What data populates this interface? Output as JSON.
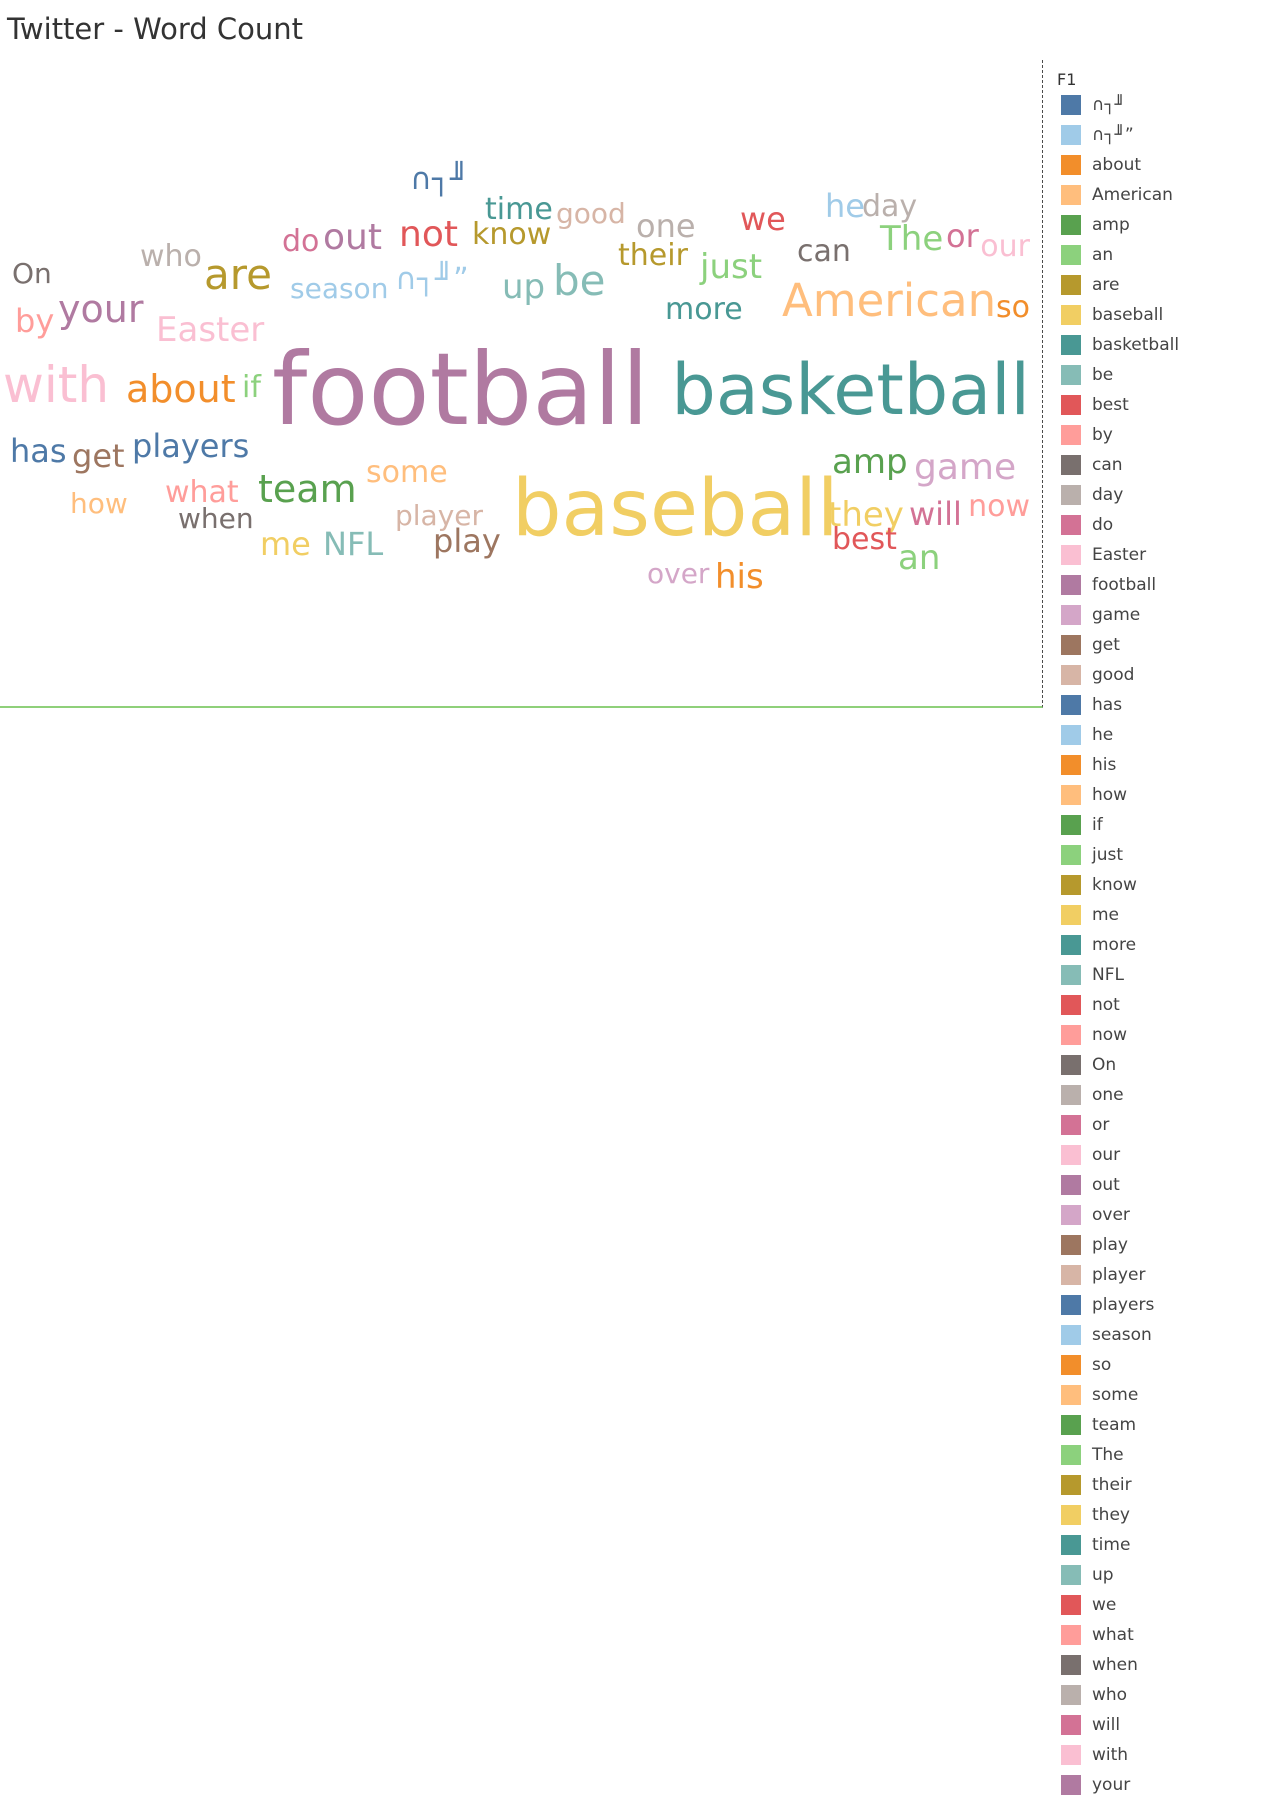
{
  "page": {
    "title": "Twitter - Word Count"
  },
  "chart_data": {
    "type": "wordcloud",
    "title": "Twitter - Word Count",
    "legend_title": "F1",
    "legend_placement": "right",
    "words": [
      {
        "text": "football",
        "size": 100,
        "color": "#b07aa1"
      },
      {
        "text": "basketball",
        "size": 70,
        "color": "#499894"
      },
      {
        "text": "baseball",
        "size": 78,
        "color": "#f1ce63"
      },
      {
        "text": "American",
        "size": 45,
        "color": "#ffbe7d"
      },
      {
        "text": "with",
        "size": 50,
        "color": "#fabfd2"
      },
      {
        "text": "are",
        "size": 42,
        "color": "#b6992d"
      },
      {
        "text": "be",
        "size": 42,
        "color": "#86bcb6"
      },
      {
        "text": "about",
        "size": 38,
        "color": "#f28e2b"
      },
      {
        "text": "your",
        "size": 38,
        "color": "#b07aa1"
      },
      {
        "text": "team",
        "size": 38,
        "color": "#59a14f"
      },
      {
        "text": "amp",
        "size": 34,
        "color": "#59a14f"
      },
      {
        "text": "game",
        "size": 36,
        "color": "#d4a6c8"
      },
      {
        "text": "out",
        "size": 36,
        "color": "#b07aa1"
      },
      {
        "text": "not",
        "size": 36,
        "color": "#e15759"
      },
      {
        "text": "players",
        "size": 32,
        "color": "#4e79a7"
      },
      {
        "text": "has",
        "size": 32,
        "color": "#4e79a7"
      },
      {
        "text": "get",
        "size": 32,
        "color": "#9d7660"
      },
      {
        "text": "just",
        "size": 34,
        "color": "#8cd17d"
      },
      {
        "text": "The",
        "size": 34,
        "color": "#8cd17d"
      },
      {
        "text": "they",
        "size": 34,
        "color": "#f1ce63"
      },
      {
        "text": "will",
        "size": 32,
        "color": "#d37295"
      },
      {
        "text": "Easter",
        "size": 34,
        "color": "#fabfd2"
      },
      {
        "text": "his",
        "size": 34,
        "color": "#f28e2b"
      },
      {
        "text": "an",
        "size": 34,
        "color": "#8cd17d"
      },
      {
        "text": "more",
        "size": 30,
        "color": "#499894"
      },
      {
        "text": "can",
        "size": 30,
        "color": "#79706e"
      },
      {
        "text": "we",
        "size": 32,
        "color": "#e15759"
      },
      {
        "text": "or",
        "size": 32,
        "color": "#d37295"
      },
      {
        "text": "one",
        "size": 32,
        "color": "#bab0ac"
      },
      {
        "text": "time",
        "size": 30,
        "color": "#499894"
      },
      {
        "text": "he",
        "size": 32,
        "color": "#a0cbe8"
      },
      {
        "text": "day",
        "size": 30,
        "color": "#bab0ac"
      },
      {
        "text": "our",
        "size": 30,
        "color": "#fabfd2"
      },
      {
        "text": "so",
        "size": 30,
        "color": "#f28e2b"
      },
      {
        "text": "up",
        "size": 34,
        "color": "#86bcb6"
      },
      {
        "text": "their",
        "size": 30,
        "color": "#b6992d"
      },
      {
        "text": "know",
        "size": 30,
        "color": "#b6992d"
      },
      {
        "text": "some",
        "size": 30,
        "color": "#ffbe7d"
      },
      {
        "text": "play",
        "size": 32,
        "color": "#9d7660"
      },
      {
        "text": "NFL",
        "size": 32,
        "color": "#86bcb6"
      },
      {
        "text": "me",
        "size": 32,
        "color": "#f1ce63"
      },
      {
        "text": "best",
        "size": 30,
        "color": "#e15759"
      },
      {
        "text": "now",
        "size": 30,
        "color": "#ff9d9a"
      },
      {
        "text": "by",
        "size": 32,
        "color": "#ff9d9a"
      },
      {
        "text": "if",
        "size": 30,
        "color": "#8cd17d"
      },
      {
        "text": "On",
        "size": 28,
        "color": "#79706e"
      },
      {
        "text": "who",
        "size": 30,
        "color": "#bab0ac"
      },
      {
        "text": "do",
        "size": 30,
        "color": "#d37295"
      },
      {
        "text": "good",
        "size": 28,
        "color": "#d7b5a6"
      },
      {
        "text": "season",
        "size": 28,
        "color": "#a0cbe8"
      },
      {
        "text": "what",
        "size": 30,
        "color": "#ff9d9a"
      },
      {
        "text": "how",
        "size": 28,
        "color": "#ffbe7d"
      },
      {
        "text": "when",
        "size": 28,
        "color": "#79706e"
      },
      {
        "text": "player",
        "size": 28,
        "color": "#d7b5a6"
      },
      {
        "text": "over",
        "size": 28,
        "color": "#d4a6c8"
      },
      {
        "text": "∩┐╜",
        "size": 30,
        "color": "#4e79a7"
      },
      {
        "text": "∩┐╜”",
        "size": 30,
        "color": "#a0cbe8"
      }
    ],
    "legend": [
      {
        "label": "∩┐╜",
        "color": "#4e79a7"
      },
      {
        "label": "∩┐╜”",
        "color": "#a0cbe8"
      },
      {
        "label": "about",
        "color": "#f28e2b"
      },
      {
        "label": "American",
        "color": "#ffbe7d"
      },
      {
        "label": "amp",
        "color": "#59a14f"
      },
      {
        "label": "an",
        "color": "#8cd17d"
      },
      {
        "label": "are",
        "color": "#b6992d"
      },
      {
        "label": "baseball",
        "color": "#f1ce63"
      },
      {
        "label": "basketball",
        "color": "#499894"
      },
      {
        "label": "be",
        "color": "#86bcb6"
      },
      {
        "label": "best",
        "color": "#e15759"
      },
      {
        "label": "by",
        "color": "#ff9d9a"
      },
      {
        "label": "can",
        "color": "#79706e"
      },
      {
        "label": "day",
        "color": "#bab0ac"
      },
      {
        "label": "do",
        "color": "#d37295"
      },
      {
        "label": "Easter",
        "color": "#fabfd2"
      },
      {
        "label": "football",
        "color": "#b07aa1"
      },
      {
        "label": "game",
        "color": "#d4a6c8"
      },
      {
        "label": "get",
        "color": "#9d7660"
      },
      {
        "label": "good",
        "color": "#d7b5a6"
      },
      {
        "label": "has",
        "color": "#4e79a7"
      },
      {
        "label": "he",
        "color": "#a0cbe8"
      },
      {
        "label": "his",
        "color": "#f28e2b"
      },
      {
        "label": "how",
        "color": "#ffbe7d"
      },
      {
        "label": "if",
        "color": "#59a14f"
      },
      {
        "label": "just",
        "color": "#8cd17d"
      },
      {
        "label": "know",
        "color": "#b6992d"
      },
      {
        "label": "me",
        "color": "#f1ce63"
      },
      {
        "label": "more",
        "color": "#499894"
      },
      {
        "label": "NFL",
        "color": "#86bcb6"
      },
      {
        "label": "not",
        "color": "#e15759"
      },
      {
        "label": "now",
        "color": "#ff9d9a"
      },
      {
        "label": "On",
        "color": "#79706e"
      },
      {
        "label": "one",
        "color": "#bab0ac"
      },
      {
        "label": "or",
        "color": "#d37295"
      },
      {
        "label": "our",
        "color": "#fabfd2"
      },
      {
        "label": "out",
        "color": "#b07aa1"
      },
      {
        "label": "over",
        "color": "#d4a6c8"
      },
      {
        "label": "play",
        "color": "#9d7660"
      },
      {
        "label": "player",
        "color": "#d7b5a6"
      },
      {
        "label": "players",
        "color": "#4e79a7"
      },
      {
        "label": "season",
        "color": "#a0cbe8"
      },
      {
        "label": "so",
        "color": "#f28e2b"
      },
      {
        "label": "some",
        "color": "#ffbe7d"
      },
      {
        "label": "team",
        "color": "#59a14f"
      },
      {
        "label": "The",
        "color": "#8cd17d"
      },
      {
        "label": "their",
        "color": "#b6992d"
      },
      {
        "label": "they",
        "color": "#f1ce63"
      },
      {
        "label": "time",
        "color": "#499894"
      },
      {
        "label": "up",
        "color": "#86bcb6"
      },
      {
        "label": "we",
        "color": "#e15759"
      },
      {
        "label": "what",
        "color": "#ff9d9a"
      },
      {
        "label": "when",
        "color": "#79706e"
      },
      {
        "label": "who",
        "color": "#bab0ac"
      },
      {
        "label": "will",
        "color": "#d37295"
      },
      {
        "label": "with",
        "color": "#fabfd2"
      },
      {
        "label": "your",
        "color": "#b07aa1"
      }
    ]
  }
}
